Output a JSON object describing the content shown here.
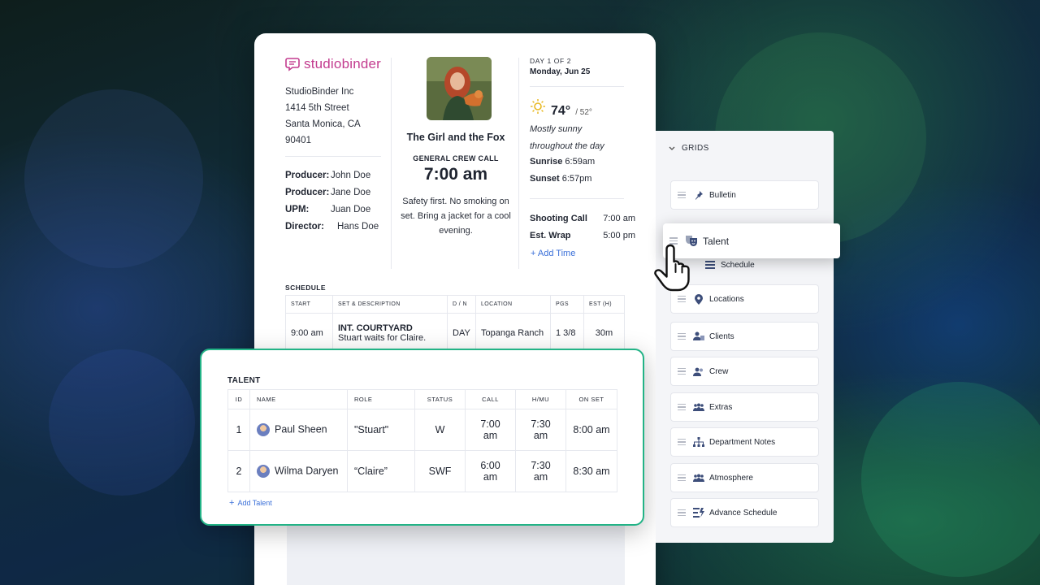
{
  "brand": {
    "logo_text": "studiobinder",
    "accent": "#c33c8f"
  },
  "company": {
    "name": "StudioBinder Inc",
    "street": "1414 5th Street",
    "city": "Santa Monica, CA",
    "zip": "90401"
  },
  "roles": [
    {
      "label": "Producer:",
      "value": "John Doe"
    },
    {
      "label": "Producer:",
      "value": "Jane Doe"
    },
    {
      "label": "UPM:",
      "value": "Juan Doe"
    },
    {
      "label": "Director:",
      "value": "Hans Doe"
    }
  ],
  "production": {
    "title": "The Girl and the Fox",
    "general_crew_call_label": "GENERAL CREW CALL",
    "call_time": "7:00 am",
    "note": "Safety first. No smoking on set. Bring a jacket for a cool evening."
  },
  "day": {
    "day_of": "DAY 1 OF 2",
    "date": "Monday, Jun 25"
  },
  "weather": {
    "icon": "sun-icon",
    "high": "74°",
    "low": "/ 52°",
    "description_line1": "Mostly sunny",
    "description_line2": "throughout the day",
    "sunrise_label": "Sunrise",
    "sunrise": "6:59am",
    "sunset_label": "Sunset",
    "sunset": "6:57pm"
  },
  "times": {
    "shooting_call_label": "Shooting Call",
    "shooting_call": "7:00 am",
    "est_wrap_label": "Est. Wrap",
    "est_wrap": "5:00 pm",
    "add_time": "+ Add Time"
  },
  "schedule": {
    "label": "SCHEDULE",
    "headers": [
      "START",
      "SET & DESCRIPTION",
      "D / N",
      "LOCATION",
      "PGS",
      "EST (H)"
    ],
    "rows": [
      {
        "start": "9:00 am",
        "set": "INT. COURTYARD",
        "description": "Stuart waits for Claire.",
        "dn": "DAY",
        "location": "Topanga Ranch",
        "pgs": "1 3/8",
        "est": "30m"
      }
    ]
  },
  "talent": {
    "label": "TALENT",
    "headers": [
      "ID",
      "NAME",
      "ROLE",
      "STATUS",
      "CALL",
      "H/MU",
      "ON SET"
    ],
    "rows": [
      {
        "id": "1",
        "name": "Paul Sheen",
        "role": "\"Stuart\"",
        "status": "W",
        "call": "7:00 am",
        "hmu": "7:30 am",
        "on_set": "8:00 am"
      },
      {
        "id": "2",
        "name": "Wilma Daryen",
        "role": "“Claire”",
        "status": "SWF",
        "call": "6:00 am",
        "hmu": "7:30 am",
        "on_set": "8:30 am"
      }
    ],
    "add_label": "Add Talent",
    "border_color": "#22b386"
  },
  "grids": {
    "header": "GRIDS",
    "items": [
      {
        "label": "Bulletin",
        "icon": "pin-icon"
      },
      {
        "label": "Schedule",
        "icon": "list-icon"
      },
      {
        "label": "Locations",
        "icon": "map-pin-icon"
      },
      {
        "label": "Clients",
        "icon": "clients-icon"
      },
      {
        "label": "Crew",
        "icon": "crew-icon"
      },
      {
        "label": "Extras",
        "icon": "extras-icon"
      },
      {
        "label": "Department Notes",
        "icon": "org-chart-icon"
      },
      {
        "label": "Atmosphere",
        "icon": "atmosphere-icon"
      },
      {
        "label": "Advance Schedule",
        "icon": "advance-schedule-icon"
      }
    ],
    "dragging_item": {
      "label": "Talent",
      "icon": "theater-masks-icon"
    }
  }
}
